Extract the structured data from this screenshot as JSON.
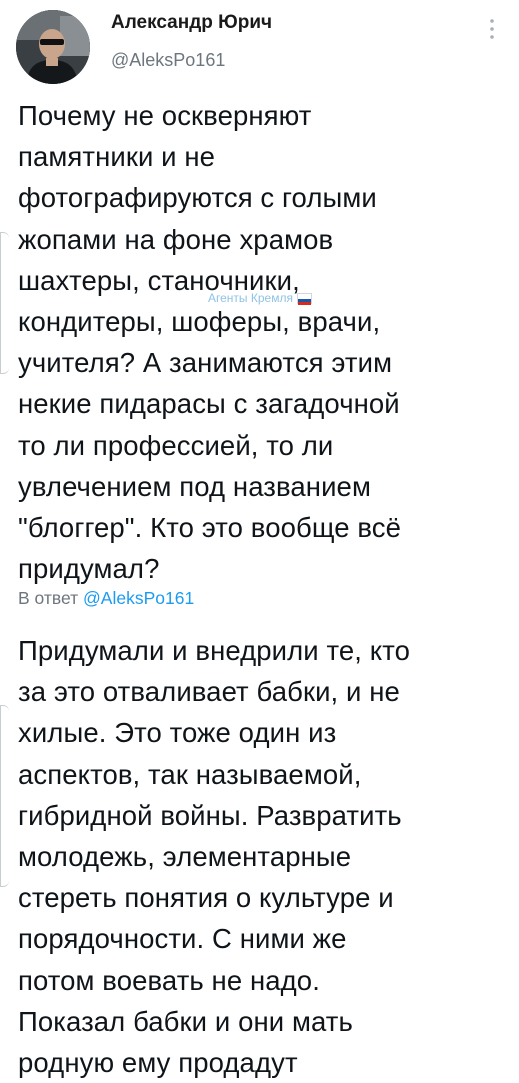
{
  "tweet": {
    "author": {
      "display_name": "Александр Юрич",
      "handle": "@AleksPo161",
      "avatar_icon": "profile-photo"
    },
    "text": "Почему не оскверняют\nпамятники и не\nфотографируются с голыми\nжопами на фоне храмов\nшахтеры, станочники,\nкондитеры, шоферы, врачи,\nучителя? А занимаются этим\nнекие пидарасы с загадочной\nто ли профессией, то ли\nувлечением под названием\n\"блоггер\". Кто это вообще всё\nпридумал?",
    "more_icon": "vertical-ellipsis-icon"
  },
  "reply": {
    "prefix": "В ответ",
    "mention": "@AleksPo161",
    "text": "Придумали и внедрили те, кто\nза это отваливает бабки, и не\nхилые. Это тоже один из\nаспектов, так называемой,\nгибридной войны. Развратить\nмолодежь, элементарные\nстереть понятия о культуре и\nпорядочности. С ними же\nпотом воевать не надо.\nПоказал бабки и они мать\nродную ему продадут"
  },
  "watermark": {
    "text": "Агенты Кремля",
    "flag_icon": "russia-flag-icon"
  },
  "colors": {
    "text": "#0f1419",
    "muted": "#6e767d",
    "link": "#1d9bf0",
    "watermark": "#8fc3e6"
  }
}
